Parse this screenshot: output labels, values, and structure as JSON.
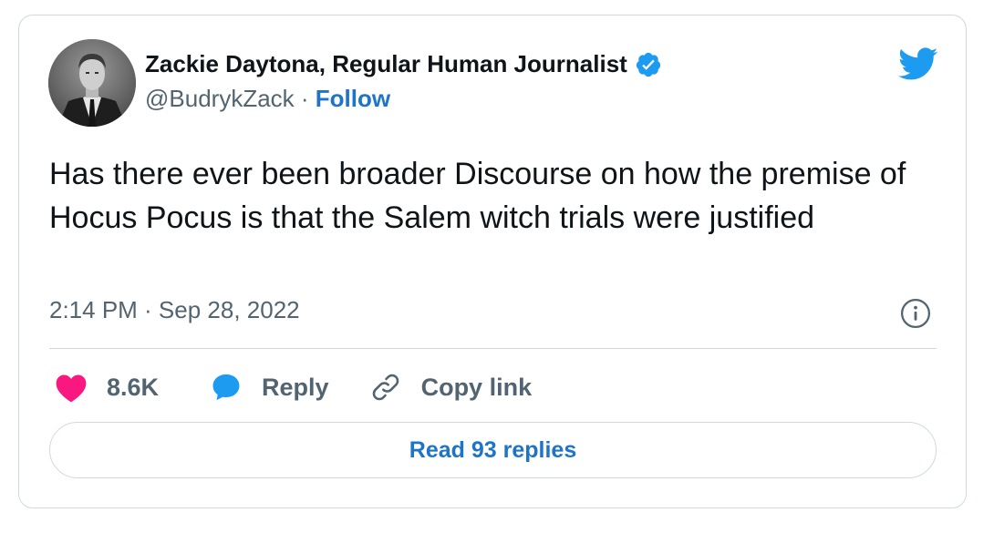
{
  "author": {
    "name": "Zackie Daytona, Regular Human Journalist",
    "handle": "@BudrykZack",
    "separator": "·",
    "follow_label": "Follow",
    "verified": true
  },
  "tweet": {
    "text": "Has there ever been broader Discourse on how the premise of Hocus Pocus is that the Salem witch trials were justified",
    "timestamp": "2:14 PM · Sep 28, 2022"
  },
  "actions": {
    "like_count": "8.6K",
    "reply_label": "Reply",
    "copy_link_label": "Copy link"
  },
  "footer": {
    "read_replies_label": "Read 93 replies"
  },
  "icons": {
    "logo": "twitter-bird-icon",
    "verified": "verified-badge-icon",
    "info": "info-icon",
    "like": "heart-icon",
    "reply": "speech-bubble-icon",
    "copy": "link-icon"
  },
  "colors": {
    "brand": "#1d9bf0",
    "link": "#1d74c8",
    "like": "#f91880",
    "text": "#0f1419",
    "muted": "#536471",
    "border": "#cfd9de"
  }
}
